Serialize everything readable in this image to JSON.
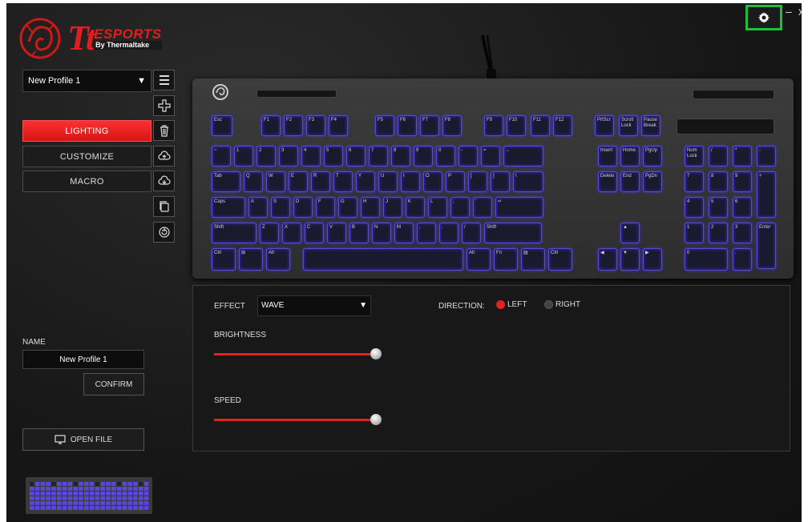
{
  "brand": {
    "logo_text": "Tt",
    "name": "ESPORTS",
    "sub": "By Thermaltake"
  },
  "window": {
    "minimize": "–",
    "close": "x"
  },
  "profile": {
    "selected": "New Profile 1"
  },
  "nav": [
    {
      "label": "LIGHTING",
      "active": true
    },
    {
      "label": "CUSTOMIZE",
      "active": false
    },
    {
      "label": "MACRO",
      "active": false
    }
  ],
  "effect": {
    "label": "EFFECT",
    "value": "WAVE"
  },
  "direction": {
    "label": "DIRECTION:",
    "left": "LEFT",
    "right": "RIGHT",
    "selected": "LEFT"
  },
  "brightness": {
    "label": "BRIGHTNESS",
    "value": 100
  },
  "speed": {
    "label": "SPEED",
    "value": 100
  },
  "name": {
    "label": "NAME",
    "value": "New Profile 1",
    "confirm": "CONFIRM"
  },
  "openfile": {
    "label": "OPEN FILE"
  },
  "colors": {
    "accent": "#e82020",
    "key_glow": "#5848d8",
    "settings_highlight": "#1fbf3d"
  },
  "keyboard": {
    "rows": [
      [
        "Esc",
        "F1",
        "F2",
        "F3",
        "F4",
        "F5",
        "F6",
        "F7",
        "F8",
        "F9",
        "F10",
        "F11",
        "F12",
        "PrtScr",
        "Scroll Lock",
        "Pause Break"
      ],
      [
        "~",
        "1",
        "2",
        "3",
        "4",
        "5",
        "6",
        "7",
        "8",
        "9",
        "0",
        "-",
        "=",
        "←",
        "Insert",
        "Home",
        "PgUp",
        "Num Lock",
        "/",
        "*",
        "-"
      ],
      [
        "Tab",
        "Q",
        "W",
        "E",
        "R",
        "T",
        "Y",
        "U",
        "I",
        "O",
        "P",
        "[",
        "]",
        "\\",
        "Delete",
        "End",
        "PgDn",
        "7",
        "8",
        "9",
        "+"
      ],
      [
        "Caps",
        "A",
        "S",
        "D",
        "F",
        "G",
        "H",
        "J",
        "K",
        "L",
        ";",
        "'",
        "↵",
        "4",
        "5",
        "6"
      ],
      [
        "Shift",
        "Z",
        "X",
        "C",
        "V",
        "B",
        "N",
        "M",
        ",",
        ".",
        "/",
        "Shift",
        "▲",
        "1",
        "2",
        "3",
        "Enter"
      ],
      [
        "Ctrl",
        "⊞",
        "Alt",
        "",
        "Alt",
        "Fn",
        "▤",
        "Ctrl",
        "◀",
        "▼",
        "▶",
        "0",
        "."
      ]
    ]
  }
}
